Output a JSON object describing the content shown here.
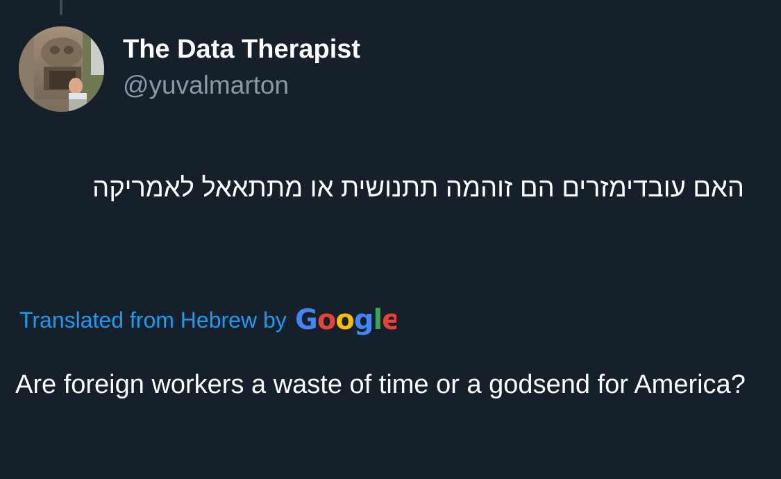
{
  "tweet": {
    "author_name": "The Data Therapist",
    "author_handle": "@yuvalmarton",
    "original_text": "האם עובדימזרים הם זוהמה תתנושית או מתתאאל לאמריקה",
    "translation_label": "Translated from Hebrew by",
    "translation_provider": "Google",
    "translated_text": "Are foreign workers a waste of time or a godsend for America?"
  },
  "colors": {
    "background": "#15202b",
    "text_primary": "#ffffff",
    "text_secondary": "#8b98a5",
    "link": "#1d9bf0",
    "google_blue": "#4285f4",
    "google_red": "#ea4335",
    "google_yellow": "#fbbc05",
    "google_green": "#34a853"
  },
  "icons": {
    "avatar": "profile-photo",
    "brand": "google-logo"
  }
}
